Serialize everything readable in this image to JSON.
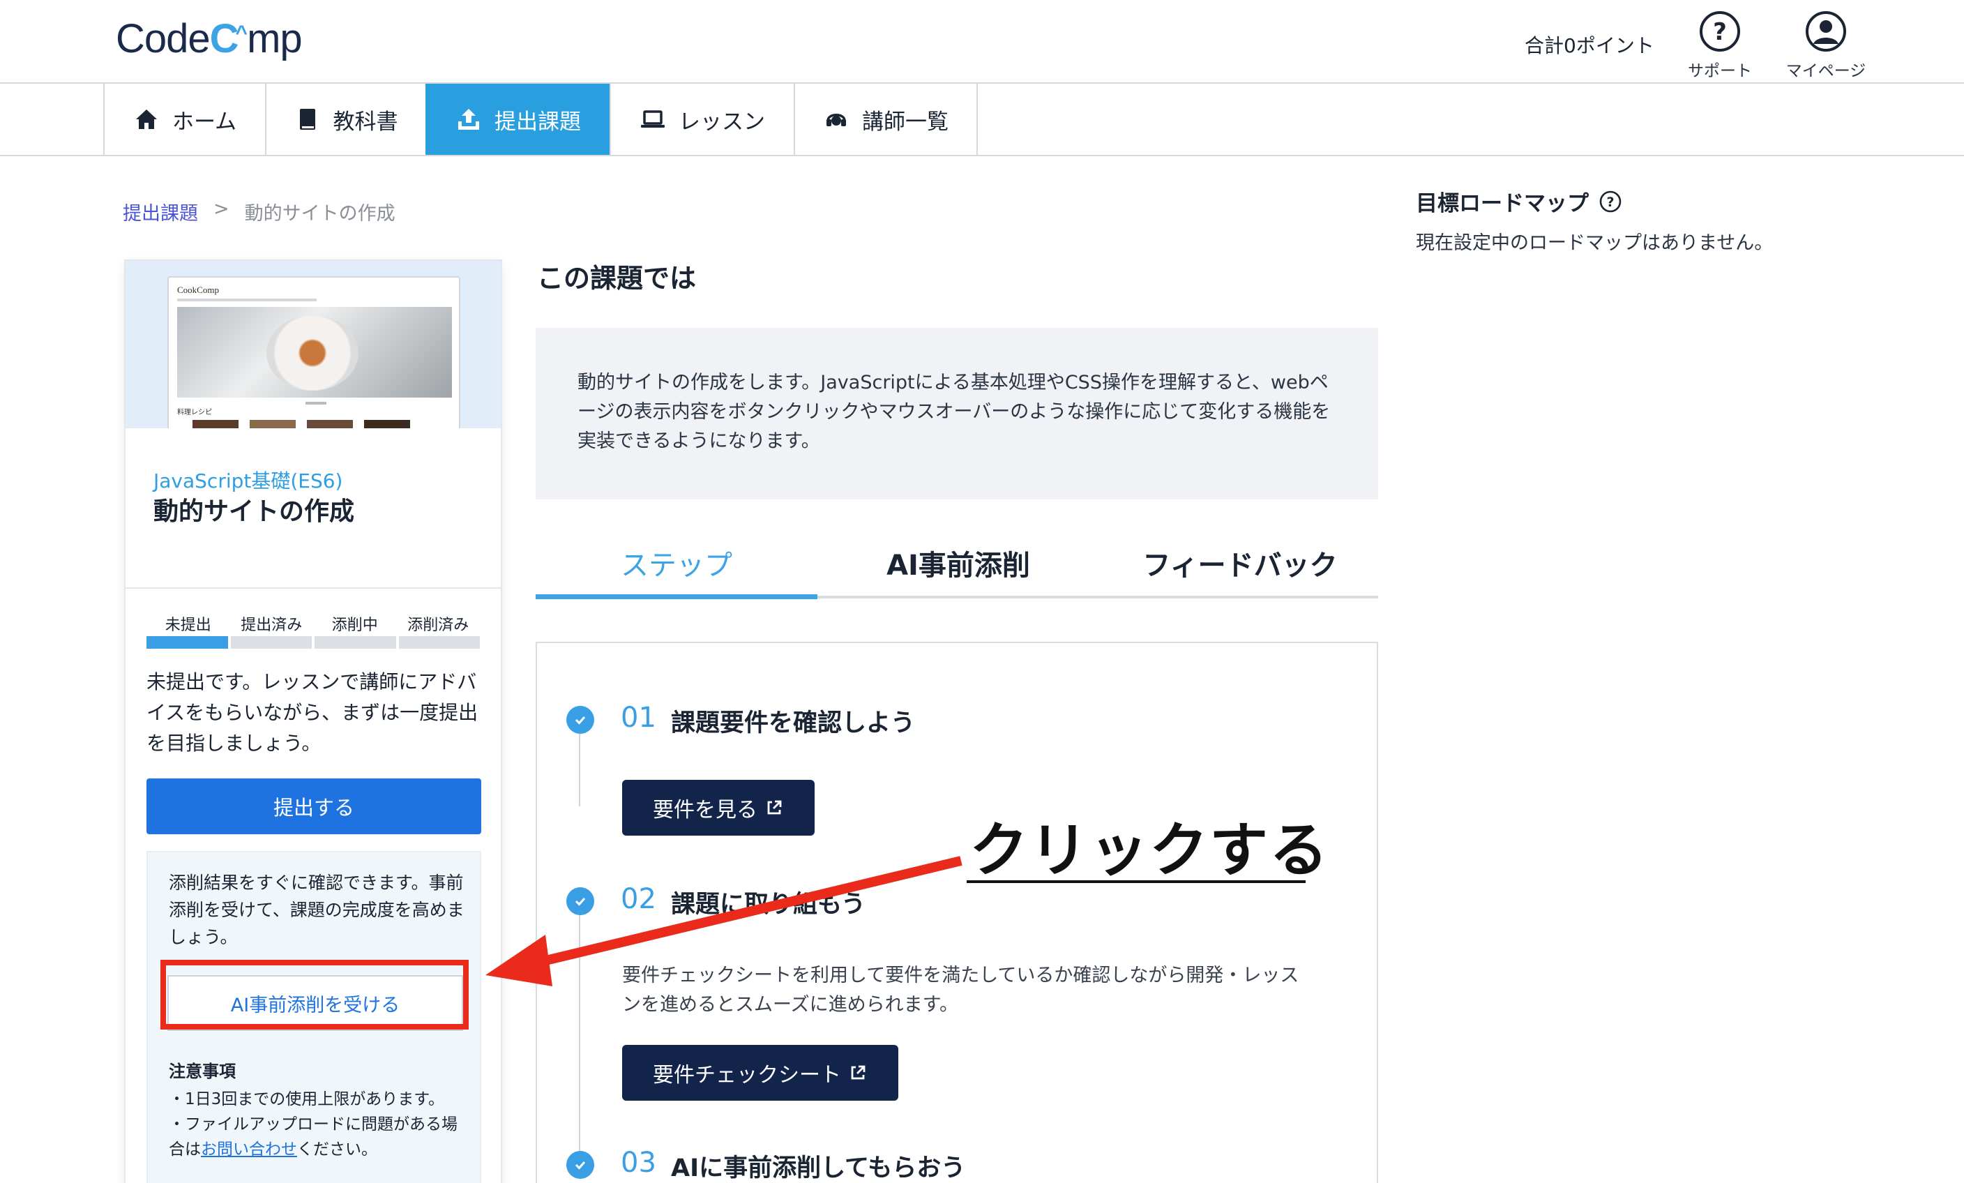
{
  "header": {
    "logo_text_a": "Code",
    "logo_hat": "C^",
    "logo_text_b": "mp",
    "points": "合計0ポイント",
    "support_label": "サポート",
    "mypage_label": "マイページ"
  },
  "nav": {
    "items": [
      {
        "label": "ホーム",
        "icon": "home-icon"
      },
      {
        "label": "教科書",
        "icon": "book-icon"
      },
      {
        "label": "提出課題",
        "icon": "upload-icon",
        "active": true
      },
      {
        "label": "レッスン",
        "icon": "laptop-icon"
      },
      {
        "label": "講師一覧",
        "icon": "headset-icon"
      }
    ]
  },
  "breadcrumb": {
    "parent": "提出課題",
    "separator": ">",
    "current": "動的サイトの作成"
  },
  "card": {
    "thumb_brand": "CookComp",
    "thumb_section": "料理レシピ",
    "category": "JavaScript基礎(ES6)",
    "title": "動的サイトの作成",
    "progress": {
      "steps": [
        "未提出",
        "提出済み",
        "添削中",
        "添削済み"
      ],
      "current_index": 0
    },
    "message": "未提出です。レッスンで講師にアドバイスをもらいながら、まずは一度提出を目指しましょう。",
    "submit_label": "提出する",
    "ai_desc": "添削結果をすぐに確認できます。事前添削を受けて、課題の完成度を高めましょう。",
    "ai_button": "AI事前添削を受ける",
    "notes_title": "注意事項",
    "note1": "・1日3回までの使用上限があります。",
    "note2_a": "・ファイルアップロードに問題がある場合は",
    "note2_link": "お問い合わせ",
    "note2_b": "ください。"
  },
  "main": {
    "section_title": "この課題では",
    "description": "動的サイトの作成をします。JavaScriptによる基本処理やCSS操作を理解すると、webページの表示内容をボタンクリックやマウスオーバーのような操作に応じて変化する機能を実装できるようになります。",
    "tabs": [
      {
        "label": "ステップ",
        "active": true
      },
      {
        "label": "AI事前添削"
      },
      {
        "label": "フィードバック"
      }
    ],
    "steps": [
      {
        "num": "01",
        "title": "課題要件を確認しよう",
        "button": "要件を見る"
      },
      {
        "num": "02",
        "title": "課題に取り組もう",
        "desc": "要件チェックシートを利用して要件を満たしているか確認しながら開発・レッスンを進めるとスムーズに進められます。",
        "button": "要件チェックシート"
      },
      {
        "num": "03",
        "title": "AIに事前添削してもらおう"
      }
    ]
  },
  "roadmap": {
    "title": "目標ロードマップ",
    "text": "現在設定中のロードマップはありません。"
  },
  "annotation": {
    "text": "クリックする",
    "color": "#ea2a1a"
  }
}
